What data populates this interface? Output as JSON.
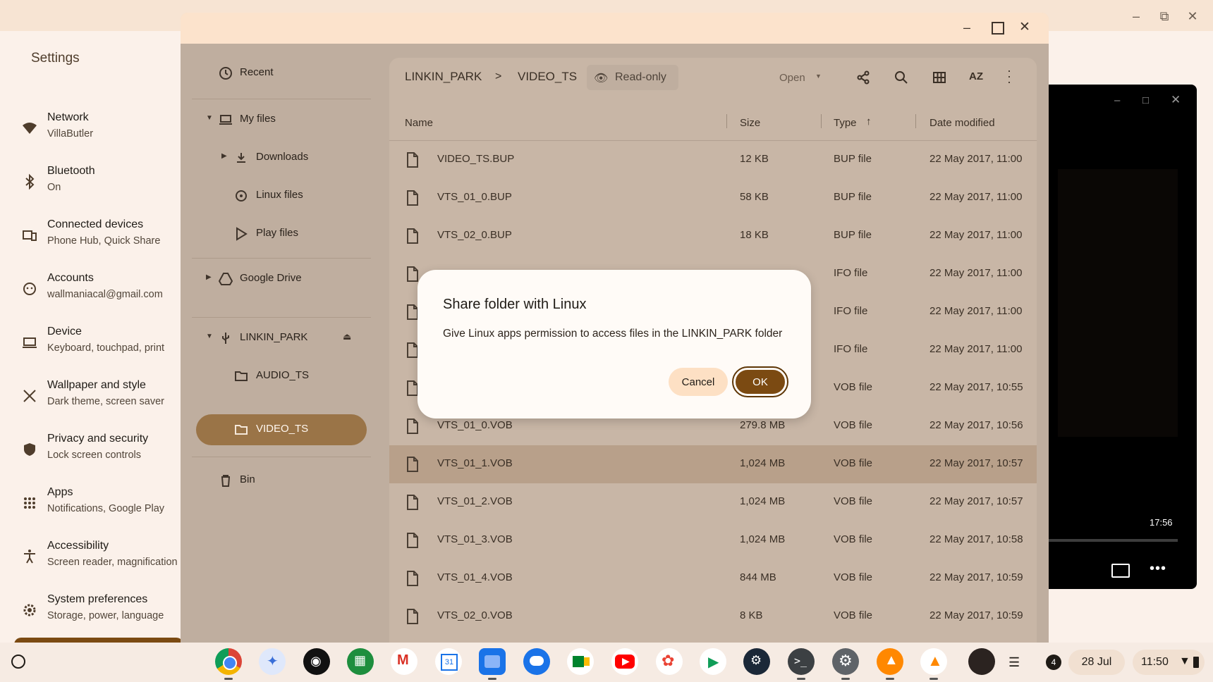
{
  "settings": {
    "title": "Settings",
    "nav": [
      {
        "title": "Network",
        "subtitle": "VillaButler",
        "icon": "wifi-icon"
      },
      {
        "title": "Bluetooth",
        "subtitle": "On",
        "icon": "bluetooth-icon"
      },
      {
        "title": "Connected devices",
        "subtitle": "Phone Hub, Quick Share",
        "icon": "connected-devices-icon"
      },
      {
        "title": "Accounts",
        "subtitle": "wallmaniacal@gmail.com",
        "icon": "account-icon"
      },
      {
        "title": "Device",
        "subtitle": "Keyboard, touchpad, print",
        "icon": "laptop-icon"
      },
      {
        "title": "Wallpaper and style",
        "subtitle": "Dark theme, screen saver",
        "icon": "palette-icon"
      },
      {
        "title": "Privacy and security",
        "subtitle": "Lock screen controls",
        "icon": "shield-icon"
      },
      {
        "title": "Apps",
        "subtitle": "Notifications, Google Play",
        "icon": "apps-grid-icon"
      },
      {
        "title": "Accessibility",
        "subtitle": "Screen reader, magnification",
        "icon": "accessibility-icon"
      },
      {
        "title": "System preferences",
        "subtitle": "Storage, power, language",
        "icon": "gear-icon"
      }
    ]
  },
  "files": {
    "sidebar": {
      "recent": "Recent",
      "my_files": "My files",
      "downloads": "Downloads",
      "linux_files": "Linux files",
      "play_files": "Play files",
      "google_drive": "Google Drive",
      "linkin_park": "LINKIN_PARK",
      "audio_ts": "AUDIO_TS",
      "video_ts": "VIDEO_TS",
      "bin": "Bin"
    },
    "breadcrumb": {
      "root": "LINKIN_PARK",
      "separator": ">",
      "current": "VIDEO_TS"
    },
    "readonly_label": "Read-only",
    "open_label": "Open",
    "sort_label": "AZ",
    "columns": {
      "name": "Name",
      "size": "Size",
      "type": "Type",
      "date": "Date modified"
    },
    "rows": [
      {
        "name": "VIDEO_TS.BUP",
        "size": "12 KB",
        "type": "BUP file",
        "date": "22 May 2017, 11:00"
      },
      {
        "name": "VTS_01_0.BUP",
        "size": "58 KB",
        "type": "BUP file",
        "date": "22 May 2017, 11:00"
      },
      {
        "name": "VTS_02_0.BUP",
        "size": "18 KB",
        "type": "BUP file",
        "date": "22 May 2017, 11:00"
      },
      {
        "name": "",
        "size": "",
        "type": "IFO file",
        "date": "22 May 2017, 11:00"
      },
      {
        "name": "",
        "size": "",
        "type": "IFO file",
        "date": "22 May 2017, 11:00"
      },
      {
        "name": "",
        "size": "",
        "type": "IFO file",
        "date": "22 May 2017, 11:00"
      },
      {
        "name": "",
        "size": "",
        "type": "VOB file",
        "date": "22 May 2017, 10:55"
      },
      {
        "name": "VTS_01_0.VOB",
        "size": "279.8 MB",
        "type": "VOB file",
        "date": "22 May 2017, 10:56"
      },
      {
        "name": "VTS_01_1.VOB",
        "size": "1,024 MB",
        "type": "VOB file",
        "date": "22 May 2017, 10:57"
      },
      {
        "name": "VTS_01_2.VOB",
        "size": "1,024 MB",
        "type": "VOB file",
        "date": "22 May 2017, 10:57"
      },
      {
        "name": "VTS_01_3.VOB",
        "size": "1,024 MB",
        "type": "VOB file",
        "date": "22 May 2017, 10:58"
      },
      {
        "name": "VTS_01_4.VOB",
        "size": "844 MB",
        "type": "VOB file",
        "date": "22 May 2017, 10:59"
      },
      {
        "name": "VTS_02_0.VOB",
        "size": "8 KB",
        "type": "VOB file",
        "date": "22 May 2017, 10:59"
      }
    ]
  },
  "dialog": {
    "title": "Share folder with Linux",
    "body": "Give Linux apps permission to access files in the LINKIN_PARK folder",
    "cancel": "Cancel",
    "ok": "OK"
  },
  "video": {
    "time": "17:56"
  },
  "shelf": {
    "apps": [
      "chrome-icon",
      "gemini-icon",
      "podcast-icon",
      "app-grid-icon",
      "gmail-icon",
      "calendar-icon",
      "files-icon",
      "messages-icon",
      "meet-icon",
      "youtube-icon",
      "photos-icon",
      "play-store-icon",
      "steam-icon",
      "terminal-icon",
      "settings-icon",
      "vlc-icon",
      "vlc-icon-2",
      "avatar-app-icon"
    ],
    "notification_count": "4",
    "date": "28 Jul",
    "time": "11:50"
  },
  "colors": {
    "accent": "#7b4a12",
    "selected": "#9a7447",
    "dialog_bg": "#fffbf7"
  }
}
